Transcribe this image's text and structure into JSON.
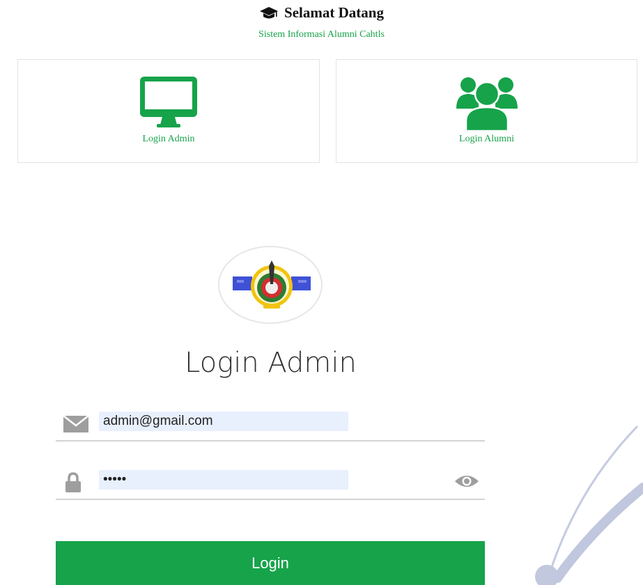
{
  "header": {
    "title": "Selamat Datang",
    "subtitle": "Sistem Informasi Alumni Cahtls",
    "title_icon": "graduation-cap-icon"
  },
  "cards": {
    "admin": {
      "label": "Login Admin",
      "icon": "monitor-icon"
    },
    "alumni": {
      "label": "Login Alumni",
      "icon": "users-icon"
    }
  },
  "login": {
    "title": "Login Admin",
    "email_value": "admin@gmail.com",
    "password_value": "admin",
    "button_label": "Login"
  },
  "colors": {
    "accent": "#16a34a",
    "autofill": "#e8f0fe",
    "icon_gray": "#9e9e9e"
  }
}
